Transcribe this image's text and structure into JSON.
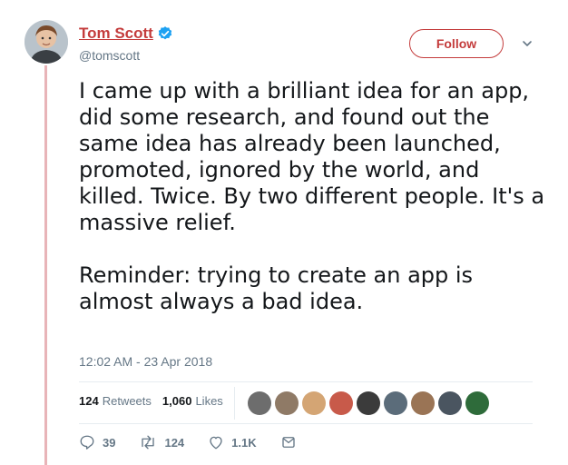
{
  "author": {
    "name": "Tom Scott",
    "handle": "@tomscott",
    "verified": true
  },
  "follow_label": "Follow",
  "tweet": {
    "text": "I came up with a brilliant idea for an app, did some research, and found out the same idea has already been launched, promoted, ignored by the world, and killed. Twice. By two different people. It's a massive relief.\n\nReminder: trying to create an app is almost always a bad idea.",
    "timestamp": "12:02 AM - 23 Apr 2018"
  },
  "stats": {
    "retweets_count": "124",
    "retweets_label": "Retweets",
    "likes_count": "1,060",
    "likes_label": "Likes"
  },
  "actions": {
    "replies": "39",
    "retweets": "124",
    "likes": "1.1K"
  },
  "colors": {
    "accent": "#c43c3c",
    "thread_line": "#e8b4b8",
    "muted_text": "#657786",
    "verified": "#1da1f2"
  }
}
